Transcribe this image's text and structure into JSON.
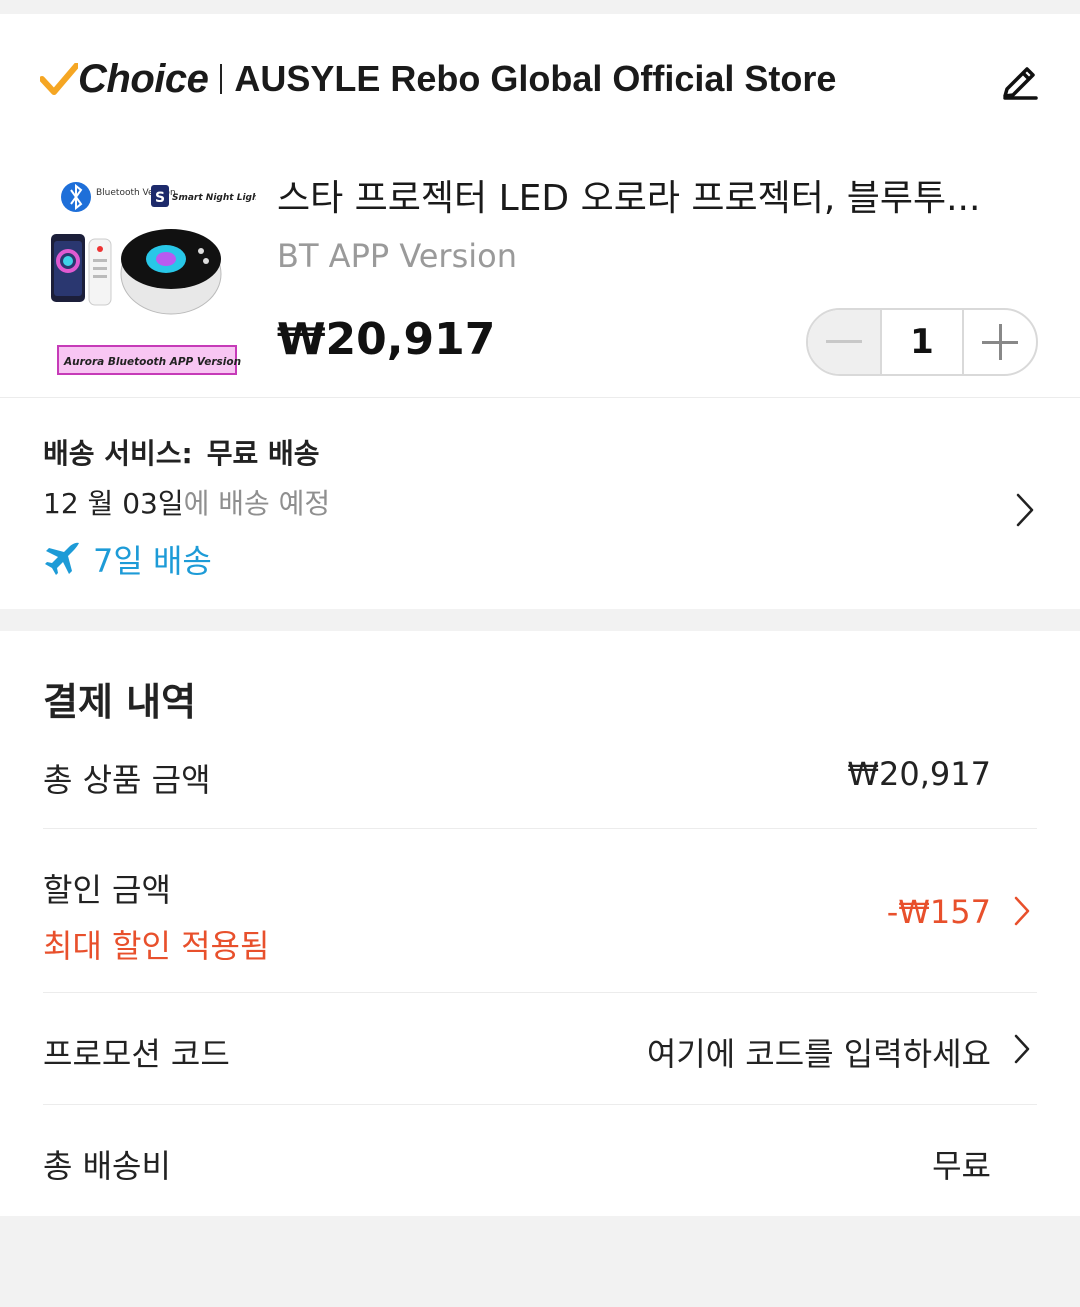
{
  "store": {
    "brand": "Choice",
    "name": "AUSYLE Rebo Global Official Store",
    "accent": "#f5a623"
  },
  "product": {
    "title": "스타 프로젝터 LED 오로라 프로젝터, 블루투...",
    "variant": "BT APP Version",
    "price": "₩20,917",
    "quantity": "1",
    "thumb_text": {
      "badge_bt": "Bluetooth Version",
      "badge_night": "Smart Night Light",
      "banner": "Aurora Bluetooth APP Version"
    }
  },
  "shipping": {
    "label": "배송 서비스:",
    "value": "무료 배송",
    "date_main": "12 월 03일",
    "date_suffix": "에 배송 예정",
    "fast_label": "7일 배송",
    "fast_color": "#1d9bd7"
  },
  "payment": {
    "title": "결제 내역",
    "rows": {
      "subtotal": {
        "label": "총 상품 금액",
        "value": "₩20,917"
      },
      "discount": {
        "label": "할인 금액",
        "note": "최대 할인 적용됨",
        "value": "-₩157",
        "color": "#e8502c"
      },
      "promo": {
        "label": "프로모션 코드",
        "value": "여기에 코드를 입력하세요"
      },
      "shipping_fee": {
        "label": "총 배송비",
        "value": "무료"
      }
    }
  }
}
